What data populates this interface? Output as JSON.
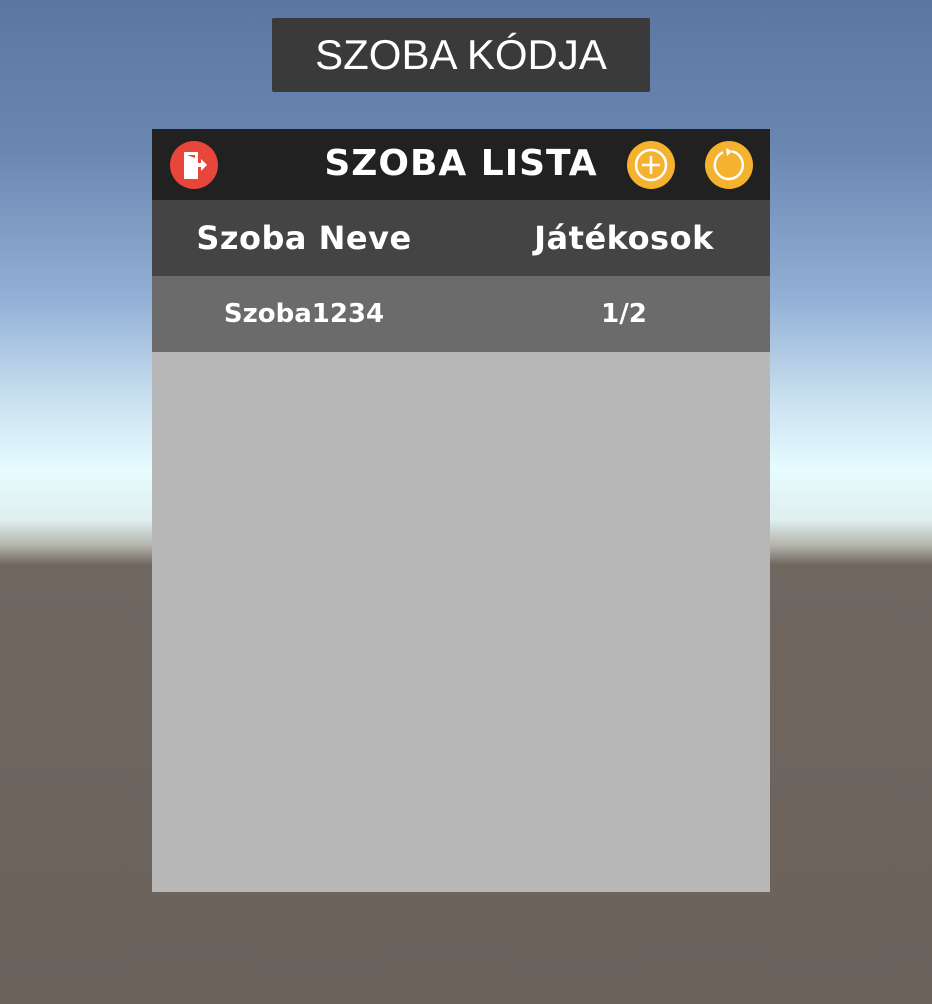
{
  "room_code_button": {
    "label": "SZOBA KÓDJA"
  },
  "room_list": {
    "title": "SZOBA LISTA",
    "icons": {
      "exit": "exit-door-icon",
      "add": "plus-circle-icon",
      "refresh": "refresh-icon"
    },
    "colors": {
      "exit": "#e8463a",
      "accent": "#f5b22f",
      "header": "#212121",
      "column_header": "#444444",
      "row": "#6b6b6b",
      "list_background": "#b7b7b7"
    },
    "columns": [
      "Szoba Neve",
      "Játékosok"
    ],
    "rooms": [
      {
        "name": "Szoba1234",
        "players": "1/2"
      }
    ]
  }
}
